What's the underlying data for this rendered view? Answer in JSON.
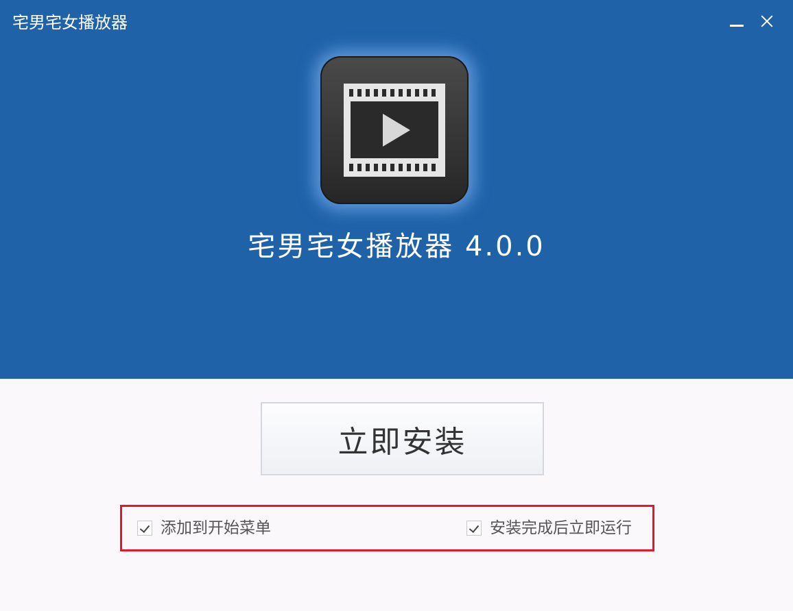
{
  "window": {
    "title": "宅男宅女播放器"
  },
  "icons": {
    "app": "film-play-icon",
    "minimize": "minimize-icon",
    "close": "close-icon",
    "check": "checkmark-icon"
  },
  "header": {
    "product_title": "宅男宅女播放器 4.0.0"
  },
  "main": {
    "install_label": "立即安装"
  },
  "options": [
    {
      "label": "添加到开始菜单",
      "checked": true
    },
    {
      "label": "安装完成后立即运行",
      "checked": true
    }
  ],
  "colors": {
    "header_bg": "#1f62a8",
    "body_bg": "#faf8fa",
    "highlight_border": "#e8162d"
  }
}
